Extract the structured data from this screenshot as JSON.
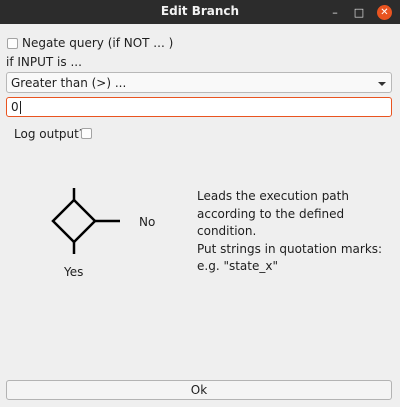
{
  "window": {
    "title": "Edit Branch",
    "minimize_glyph": "–",
    "maximize_glyph": "□",
    "close_glyph": "✕"
  },
  "form": {
    "negate_label": "Negate query (if NOT ... )",
    "negate_checked": false,
    "condition_label": "if INPUT is ...",
    "condition_value": "Greater than (>) ...",
    "value_input": "0",
    "log_label": "Log output?",
    "log_checked": false
  },
  "diagram": {
    "no_label": "No",
    "yes_label": "Yes",
    "icon": "branch-diamond-icon"
  },
  "info_lines": [
    "Leads the execution path",
    "according to the defined condition.",
    "Put strings in quotation marks:",
    "e.g. \"state_x\""
  ],
  "ok_label": "Ok",
  "colors": {
    "titlebar": "#2c2c2c",
    "accent": "#e95420",
    "background": "#efefef"
  }
}
